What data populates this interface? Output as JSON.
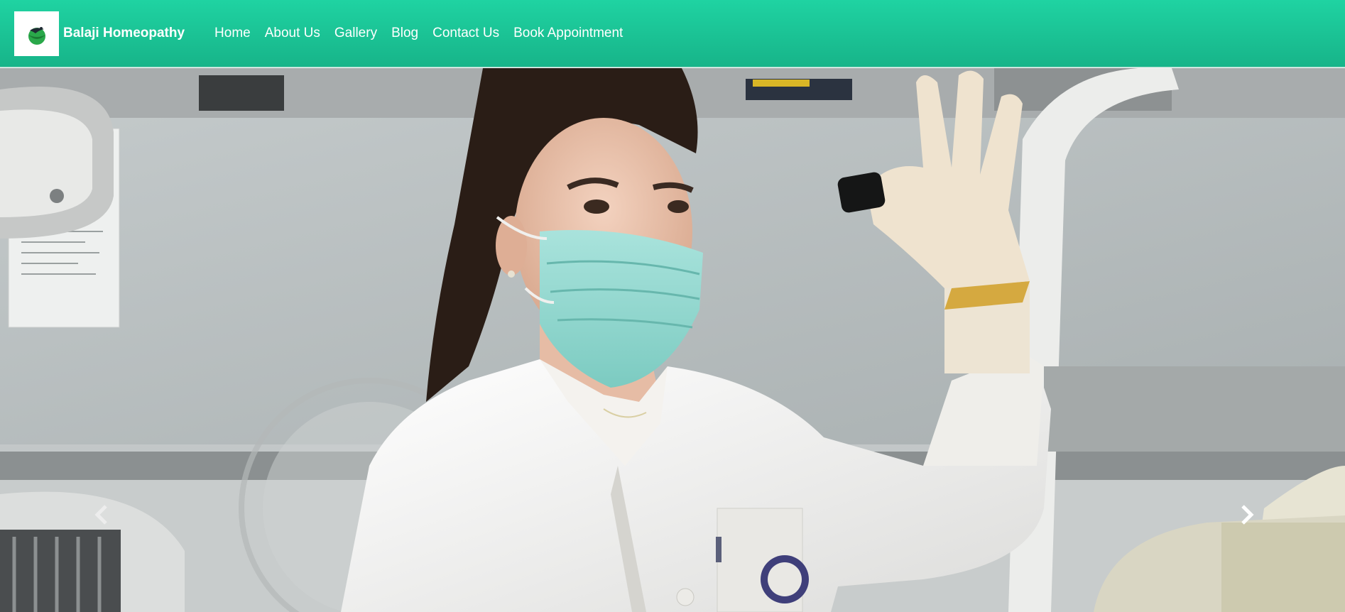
{
  "brand": {
    "name": "Balaji Homeopathy",
    "logo_icon": "leaf-bird-logo",
    "colors": {
      "primary": "#1ac89b",
      "dark": "#17b489"
    }
  },
  "nav": {
    "items": [
      {
        "label": "Home"
      },
      {
        "label": "About Us"
      },
      {
        "label": "Gallery"
      },
      {
        "label": "Blog"
      },
      {
        "label": "Contact Us"
      },
      {
        "label": "Book Appointment"
      }
    ]
  },
  "carousel": {
    "prev_icon": "chevron-left-icon",
    "next_icon": "chevron-right-icon",
    "slide": {
      "image": "doctor-in-lab-coat-with-mask-holding-dental-film"
    }
  }
}
